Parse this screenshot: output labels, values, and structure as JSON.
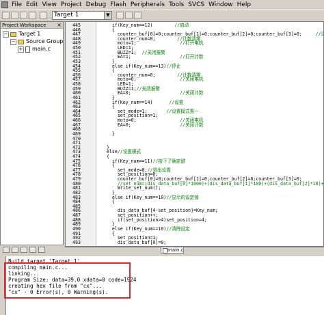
{
  "menu": [
    "File",
    "Edit",
    "View",
    "Project",
    "Debug",
    "Flash",
    "Peripherals",
    "Tools",
    "SVCS",
    "Window",
    "Help"
  ],
  "toolbar": {
    "target": "Target 1"
  },
  "workspace": {
    "title": "Project Workspace",
    "tree": [
      {
        "label": "Target 1",
        "level": 0,
        "kind": "folder",
        "toggle": "⊟"
      },
      {
        "label": "Source Group 1",
        "level": 1,
        "kind": "folder",
        "toggle": "⊟"
      },
      {
        "label": "main.c",
        "level": 2,
        "kind": "file",
        "toggle": "⊞"
      }
    ]
  },
  "editor": {
    "tab": "main.c",
    "lines": [
      {
        "n": "445",
        "t": "    if(Key_num==12)",
        "c": "        //启动"
      },
      {
        "n": "446",
        "t": "    {",
        "c": ""
      },
      {
        "n": "447",
        "t": "      counter_buf[0]=0;counter_buf[1]=0;counter_buf[2]=0;counter_buf[3]=0;",
        "c": "     //清除显示"
      },
      {
        "n": "448",
        "t": "      counter_num=0;",
        "c": "        //计数清零"
      },
      {
        "n": "449",
        "t": "      moto=1;",
        "c": "                //打开电机"
      },
      {
        "n": "450",
        "t": "      LED=1;",
        "c": ""
      },
      {
        "n": "451",
        "t": "      BUZZ=1;",
        "c": "  //关闭报警"
      },
      {
        "n": "452",
        "t": "      EA=1;",
        "c": "                  //打开计数"
      },
      {
        "n": "453",
        "t": "    }",
        "c": ""
      },
      {
        "n": "454",
        "t": "    else if(Key_num==13)",
        "c": "//停止"
      },
      {
        "n": "455",
        "t": "    {",
        "c": ""
      },
      {
        "n": "456",
        "t": "      counter_num=0;",
        "c": "        //计数清零"
      },
      {
        "n": "457",
        "t": "      moto=0;",
        "c": "                //关闭电机"
      },
      {
        "n": "458",
        "t": "      LED=1;",
        "c": ""
      },
      {
        "n": "459",
        "t": "      BUZZ=1;",
        "c": "//关闭报警"
      },
      {
        "n": "460",
        "t": "      EA=0;",
        "c": "                  //关闭计数"
      },
      {
        "n": "461",
        "t": "    }",
        "c": ""
      },
      {
        "n": "462",
        "t": "    if(Key_num==14)",
        "c": "      //设置"
      },
      {
        "n": "463",
        "t": "    {",
        "c": ""
      },
      {
        "n": "464",
        "t": "      set_mode=1;",
        "c": "       //设置模式置一"
      },
      {
        "n": "465",
        "t": "      set_position=1;",
        "c": ""
      },
      {
        "n": "466",
        "t": "      moto=0;",
        "c": "                //关闭电机"
      },
      {
        "n": "467",
        "t": "      EA=0;",
        "c": "                  //关闭计数"
      },
      {
        "n": "468",
        "t": "",
        "c": ""
      },
      {
        "n": "469",
        "t": "    }",
        "c": ""
      },
      {
        "n": "470",
        "t": "",
        "c": ""
      },
      {
        "n": "471",
        "t": "",
        "c": ""
      },
      {
        "n": "472",
        "t": "  }",
        "c": ""
      },
      {
        "n": "473",
        "t": "  else",
        "c": "//设置模式"
      },
      {
        "n": "474",
        "t": "  {",
        "c": ""
      },
      {
        "n": "475",
        "t": "    if(Key_num==11)",
        "c": "//按下了确定键"
      },
      {
        "n": "476",
        "t": "    {",
        "c": ""
      },
      {
        "n": "477",
        "t": "      set_mode=0;",
        "c": "//退出设置"
      },
      {
        "n": "478",
        "t": "      set_position=0;",
        "c": ""
      },
      {
        "n": "479",
        "t": "      counter_buf[0]=0;counter_buf[1]=0;counter_buf[2]=0;counter_buf[3]=0;",
        "c": ""
      },
      {
        "n": "480",
        "t": "      ",
        "c": "//set_num=(dis_data_buf[0]*1000)+(dis_data_buf[1]*100)+(dis_data_buf[2]*10)+dis_data_buf[3];"
      },
      {
        "n": "481",
        "t": "      Write_set_num();",
        "c": ""
      },
      {
        "n": "482",
        "t": "    }",
        "c": ""
      },
      {
        "n": "483",
        "t": "    else if(Key_num==10)",
        "c": "//显示的设定值"
      },
      {
        "n": "484",
        "t": "    {",
        "c": ""
      },
      {
        "n": "485",
        "t": "",
        "c": ""
      },
      {
        "n": "486",
        "t": "      dis_data_buf[4-set_position]=Key_num;",
        "c": ""
      },
      {
        "n": "487",
        "t": "      set_position++;",
        "c": ""
      },
      {
        "n": "488",
        "t": "      if(set_position>4)set_position=4;",
        "c": ""
      },
      {
        "n": "489",
        "t": "    }",
        "c": ""
      },
      {
        "n": "490",
        "t": "    else if(Key_num==10)",
        "c": "//清除设定"
      },
      {
        "n": "491",
        "t": "    {",
        "c": ""
      },
      {
        "n": "492",
        "t": "      set_position=1;",
        "c": ""
      },
      {
        "n": "493",
        "t": "      dis_data_buf[0]=0;",
        "c": ""
      }
    ]
  },
  "output": {
    "lines": [
      "Build target 'Target 1'",
      "compiling main.c...",
      "linking...",
      "Program Size: data=39.0 xdata=0 code=1924",
      "creating hex file from \"cx\"...",
      "\"cx\" - 0 Error(s), 0 Warning(s)."
    ]
  },
  "colors": {
    "highlight": "#e0242c",
    "keyword": "#0000c0",
    "comment": "#008000"
  }
}
